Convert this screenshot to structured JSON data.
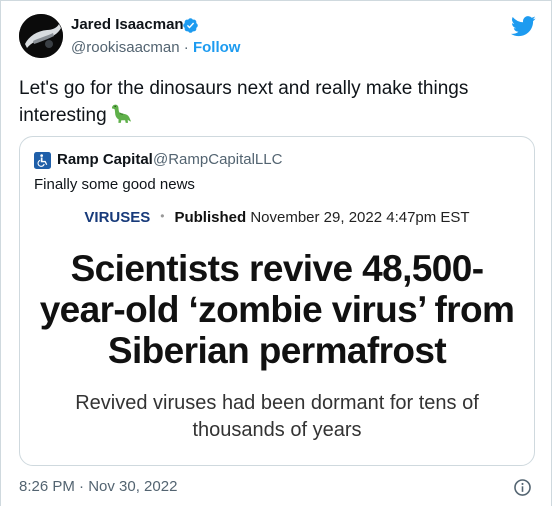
{
  "author": {
    "name": "Jared Isaacman",
    "handle": "@rookisaacman",
    "separator": "·",
    "follow_label": "Follow"
  },
  "tweet": {
    "text": "Let's go for the dinosaurs next and really make things interesting",
    "emoji": "sauropod"
  },
  "quoted": {
    "name": "Ramp Capital",
    "handle": "@RampCapitalLLC",
    "text": "Finally some good news",
    "article": {
      "category": "VIRUSES",
      "dot": "•",
      "published_label": "Published",
      "date": "November 29, 2022 4:47pm EST",
      "headline": "Scientists revive 48,500-year-old ‘zombie virus’ from Siberian permafrost",
      "subhead": "Revived viruses had been dormant for tens of thousands of years"
    }
  },
  "footer": {
    "timestamp": "8:26 PM · Nov 30, 2022"
  },
  "colors": {
    "accent": "#1d9bf0",
    "text": "#0f1419",
    "secondary": "#536471",
    "border": "#cfd9de",
    "category": "#173a7a"
  },
  "icons": [
    "avatar-image",
    "verified-badge-icon",
    "twitter-bird-icon",
    "accessibility-icon",
    "info-icon"
  ]
}
